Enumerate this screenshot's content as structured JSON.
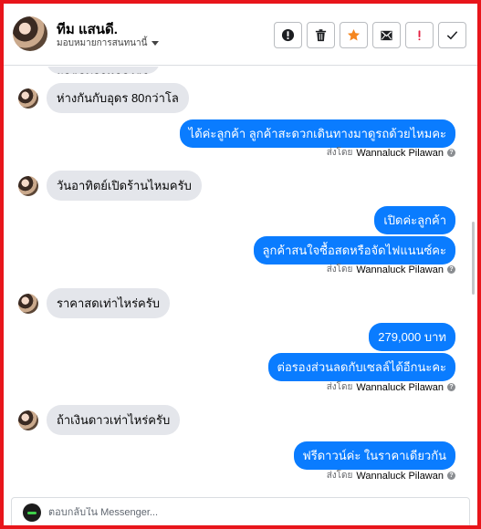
{
  "header": {
    "name": "ทีม แสนดี.",
    "assign_label": "มอบหมายการสนทนานี้"
  },
  "toolbar": [
    {
      "name": "mark-spam-button",
      "icon": "alert-circle-icon"
    },
    {
      "name": "delete-button",
      "icon": "trash-icon"
    },
    {
      "name": "star-button",
      "icon": "star-icon"
    },
    {
      "name": "mark-unread-button",
      "icon": "envelope-icon"
    },
    {
      "name": "follow-up-button",
      "icon": "exclamation-icon"
    },
    {
      "name": "mark-done-button",
      "icon": "check-icon"
    }
  ],
  "colors": {
    "frame": "#e8151b",
    "outgoing_bubble": "#0a7cff",
    "incoming_bubble": "#e4e6eb",
    "star": "#f5861f",
    "alert": "#e41e3f"
  },
  "messages": {
    "clipped_top": "ผลตอบอาหกลงตา",
    "in_1": "ห่างกันกับอุดร 80กว่าโล",
    "out_1": "ได้ค่ะลูกค้า ลูกค้าสะดวกเดินทางมาดูรถด้วยไหมคะ",
    "in_2": "วันอาทิตย์เปิดร้านไหมครับ",
    "out_2a": "เปิดค่ะลูกค้า",
    "out_2b": "ลูกค้าสนใจซื้อสดหรือจัดไฟแนนซ์คะ",
    "in_3": "ราคาสดเท่าไหร่ครับ",
    "out_3a": "279,000  บาท",
    "out_3b": "ต่อรองส่วนลดกับเซลล์ได้อีกนะคะ",
    "in_4": "ถ้าเงินดาวเท่าไหร่ครับ",
    "out_4": "ฟรีดาวน์ค่ะ   ในราคาเดียวกัน"
  },
  "sent_by": {
    "prefix": "ส่งโดย",
    "agent": "Wannaluck Pilawan",
    "help": "?"
  },
  "reply": {
    "placeholder": "ตอบกลับใน Messenger..."
  }
}
